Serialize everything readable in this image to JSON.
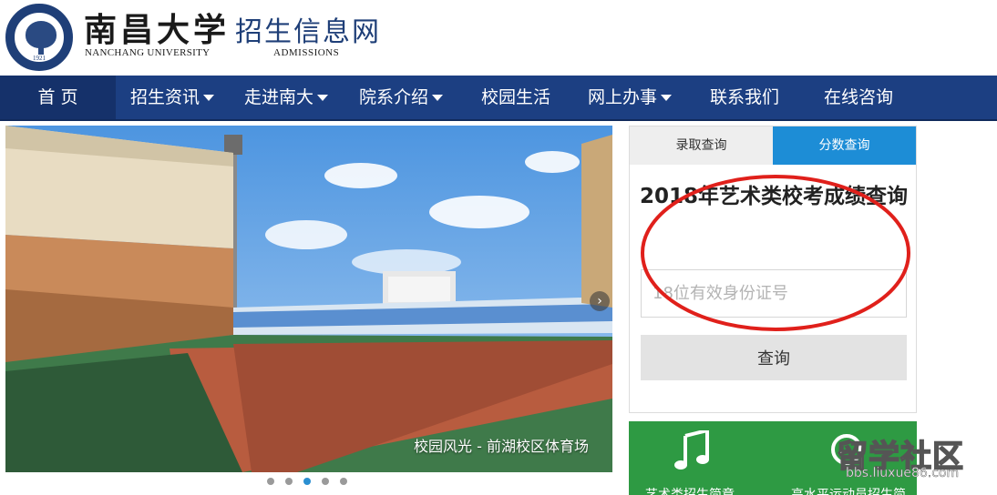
{
  "header": {
    "school_name_cn": "南昌大学",
    "school_name_en": "NANCHANG UNIVERSITY",
    "site_name_cn": "招生信息网",
    "site_name_en": "ADMISSIONS",
    "seal_year": "1921"
  },
  "nav": {
    "items": [
      {
        "label": "首 页",
        "dropdown": false,
        "active": true
      },
      {
        "label": "招生资讯",
        "dropdown": true
      },
      {
        "label": "走进南大",
        "dropdown": true
      },
      {
        "label": "院系介绍",
        "dropdown": true
      },
      {
        "label": "校园生活",
        "dropdown": false
      },
      {
        "label": "网上办事",
        "dropdown": true
      },
      {
        "label": "联系我们",
        "dropdown": false
      },
      {
        "label": "在线咨询",
        "dropdown": false
      }
    ]
  },
  "slider": {
    "caption": "校园风光 - 前湖校区体育场",
    "dot_count": 5,
    "active_dot": 3,
    "next_arrow": "›"
  },
  "query": {
    "tabs": [
      "录取查询",
      "分数查询"
    ],
    "active_tab": 1,
    "title": "2018年艺术类校考成绩查询",
    "input_placeholder": "18位有效身份证号",
    "button_label": "查询",
    "annotation_color": "#e0201b"
  },
  "quick_links": {
    "items": [
      {
        "label": "艺术类招生简章",
        "icon": "music-note-icon"
      },
      {
        "label": "高水平运动员招生简",
        "icon": "sports-icon"
      }
    ]
  },
  "watermark": {
    "text": "留学社区",
    "url": "bbs.liuxue86.com"
  },
  "colors": {
    "nav_bg": "#1c3f82",
    "tab_active": "#1d8dd6",
    "green_panel": "#2e9a43"
  }
}
